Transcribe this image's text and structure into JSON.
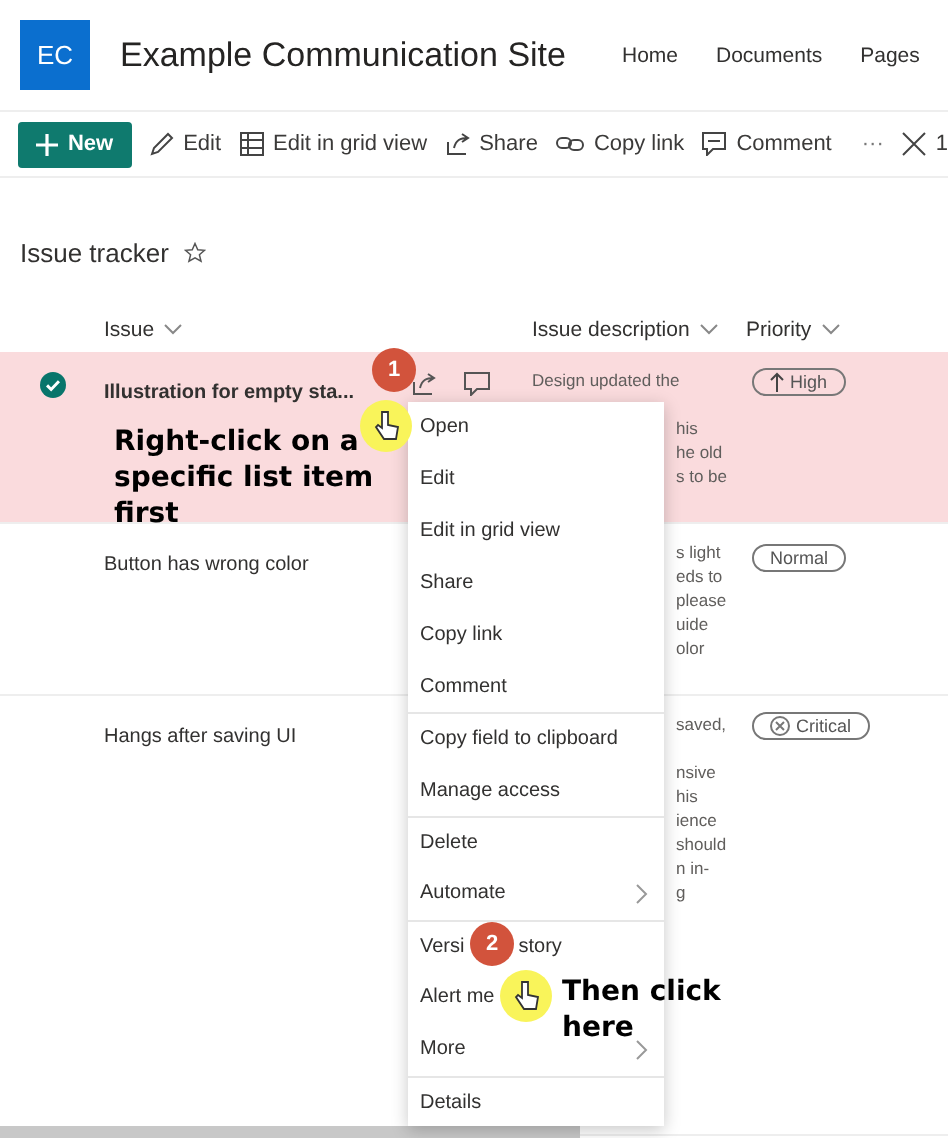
{
  "site": {
    "logo": "EC",
    "title": "Example Communication Site",
    "nav": [
      {
        "label": "Home"
      },
      {
        "label": "Documents"
      },
      {
        "label": "Pages"
      }
    ]
  },
  "toolbar": {
    "new_button": "New",
    "items": [
      {
        "kind": "edit",
        "label": "Edit"
      },
      {
        "kind": "grid",
        "label": "Edit in grid view"
      },
      {
        "kind": "share",
        "label": "Share"
      },
      {
        "kind": "link",
        "label": "Copy link"
      },
      {
        "kind": "comment",
        "label": "Comment"
      }
    ],
    "more": "···",
    "close_count": "1"
  },
  "list": {
    "title": "Issue tracker",
    "favorite": false,
    "columns": [
      {
        "label": "Issue"
      },
      {
        "label": "Issue description"
      },
      {
        "label": "Priority"
      }
    ],
    "rows": [
      {
        "selected": true,
        "issue": "Illustration for empty sta...",
        "description_head": "Design updated the",
        "description_fragments": [
          [
            "his",
            "he old",
            "s to be"
          ]
        ],
        "priority": {
          "kind": "high",
          "label": "High"
        }
      },
      {
        "selected": false,
        "issue": "Button has wrong color",
        "description_fragments": [
          [
            "s light",
            "eds to",
            "please",
            "uide",
            "olor"
          ]
        ],
        "priority": {
          "kind": "normal",
          "label": "Normal"
        }
      },
      {
        "selected": false,
        "issue": "Hangs after saving UI",
        "description_fragments": [
          [
            "saved,"
          ],
          [
            "nsive",
            "his",
            "ience",
            "should",
            "n in-",
            "g"
          ]
        ],
        "priority": {
          "kind": "critical",
          "label": "Critical"
        }
      }
    ]
  },
  "context_menu": [
    {
      "label": "Open",
      "separator_before": false,
      "submenu": false
    },
    {
      "label": "Edit",
      "separator_before": false,
      "submenu": false
    },
    {
      "label": "Edit in grid view",
      "separator_before": false,
      "submenu": false
    },
    {
      "label": "Share",
      "separator_before": false,
      "submenu": false
    },
    {
      "label": "Copy link",
      "separator_before": false,
      "submenu": false
    },
    {
      "label": "Comment",
      "separator_before": false,
      "submenu": false
    },
    {
      "label": "Copy field to clipboard",
      "separator_before": true,
      "submenu": false
    },
    {
      "label": "Manage access",
      "separator_before": false,
      "submenu": false
    },
    {
      "label": "Delete",
      "separator_before": true,
      "submenu": false
    },
    {
      "label": "Automate",
      "separator_before": false,
      "submenu": true
    },
    {
      "label": "Versi",
      "label_after_badge": "story",
      "separator_before": true,
      "submenu": false
    },
    {
      "label": "Alert me",
      "separator_before": false,
      "submenu": false
    },
    {
      "label": "More",
      "separator_before": false,
      "submenu": true
    },
    {
      "label": "Details",
      "separator_before": true,
      "submenu": false
    }
  ],
  "callouts": [
    {
      "step": "1",
      "text": "Right-click on a specific list item first"
    },
    {
      "step": "2",
      "text": "Then click here"
    }
  ]
}
